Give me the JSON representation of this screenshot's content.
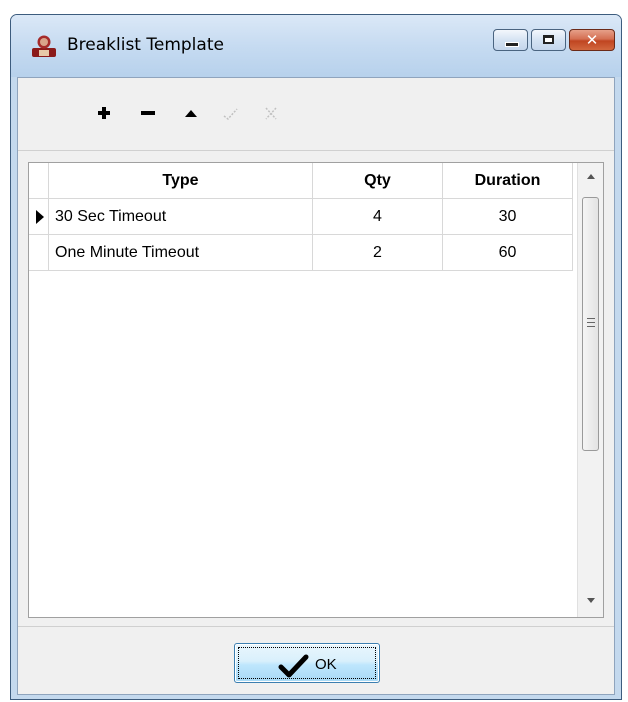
{
  "window": {
    "title": "Breaklist Template",
    "icon": "app-person-icon"
  },
  "caption_buttons": {
    "minimize": "minimize-icon",
    "maximize": "maximize-icon",
    "close_glyph": "✕"
  },
  "toolbar": {
    "buttons": [
      {
        "name": "add",
        "icon": "plus-icon",
        "enabled": true
      },
      {
        "name": "remove",
        "icon": "minus-icon",
        "enabled": true
      },
      {
        "name": "move-up",
        "icon": "triangle-up-icon",
        "enabled": true
      },
      {
        "name": "confirm",
        "icon": "check-icon",
        "enabled": false
      },
      {
        "name": "cancel",
        "icon": "x-icon",
        "enabled": false
      }
    ]
  },
  "grid": {
    "columns": [
      "Type",
      "Qty",
      "Duration"
    ],
    "rows": [
      {
        "type": "30 Sec Timeout",
        "qty": "4",
        "duration": "30",
        "current": true
      },
      {
        "type": "One Minute Timeout",
        "qty": "2",
        "duration": "60",
        "current": false
      }
    ]
  },
  "footer": {
    "ok_label": "OK"
  },
  "colors": {
    "title_bar": "#c6dbf1",
    "close_button": "#c04521",
    "client_bg": "#f0f0f0",
    "ok_button": "#bee6fd"
  }
}
